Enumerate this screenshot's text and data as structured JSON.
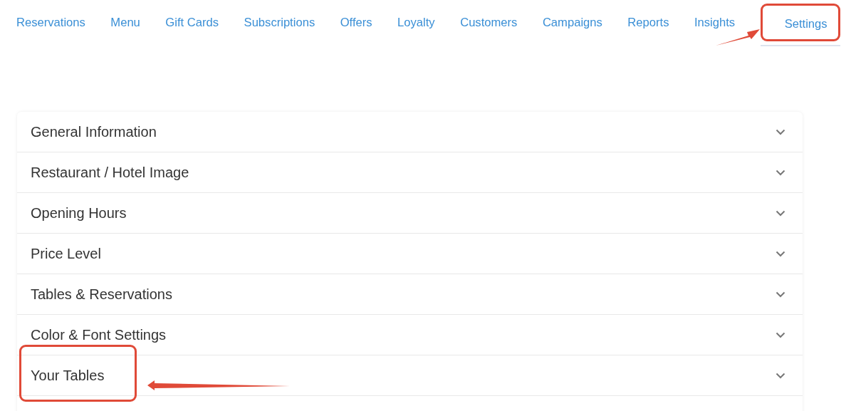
{
  "nav": {
    "tabs": [
      {
        "label": "Reservations",
        "selected": false,
        "highlighted": false
      },
      {
        "label": "Menu",
        "selected": false,
        "highlighted": false
      },
      {
        "label": "Gift Cards",
        "selected": false,
        "highlighted": false
      },
      {
        "label": "Subscriptions",
        "selected": false,
        "highlighted": false
      },
      {
        "label": "Offers",
        "selected": false,
        "highlighted": false
      },
      {
        "label": "Loyalty",
        "selected": false,
        "highlighted": false
      },
      {
        "label": "Customers",
        "selected": false,
        "highlighted": false
      },
      {
        "label": "Campaigns",
        "selected": false,
        "highlighted": false
      },
      {
        "label": "Reports",
        "selected": false,
        "highlighted": false
      },
      {
        "label": "Insights",
        "selected": false,
        "highlighted": false
      },
      {
        "label": "Settings",
        "selected": true,
        "highlighted": true
      }
    ]
  },
  "sections": [
    {
      "title": "General Information",
      "expanded": false,
      "highlighted": false
    },
    {
      "title": "Restaurant / Hotel Image",
      "expanded": false,
      "highlighted": false
    },
    {
      "title": "Opening Hours",
      "expanded": false,
      "highlighted": false
    },
    {
      "title": "Price Level",
      "expanded": false,
      "highlighted": false
    },
    {
      "title": "Tables & Reservations",
      "expanded": false,
      "highlighted": false
    },
    {
      "title": "Color & Font Settings",
      "expanded": false,
      "highlighted": false
    },
    {
      "title": "Your Tables",
      "expanded": false,
      "highlighted": true
    }
  ]
}
